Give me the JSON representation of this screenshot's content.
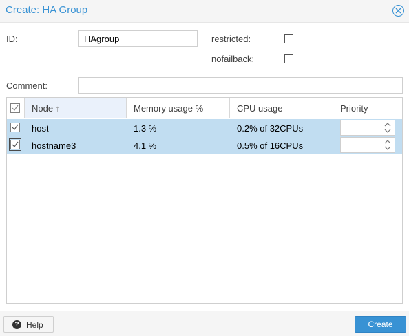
{
  "dialog": {
    "title": "Create: HA Group"
  },
  "form": {
    "id_label": "ID:",
    "id_value": "HAgroup",
    "restricted_label": "restricted:",
    "restricted_checked": false,
    "nofailback_label": "nofailback:",
    "nofailback_checked": false,
    "comment_label": "Comment:",
    "comment_value": ""
  },
  "grid": {
    "columns": [
      {
        "label": "Node",
        "sort": "ascending"
      },
      {
        "label": "Memory usage %"
      },
      {
        "label": "CPU usage"
      },
      {
        "label": "Priority"
      }
    ],
    "select_all_checked": false,
    "rows": [
      {
        "node": "host",
        "memory": "1.3 %",
        "cpu": "0.2% of 32CPUs",
        "priority": "",
        "checked": true
      },
      {
        "node": "hostname3",
        "memory": "4.1 %",
        "cpu": "0.5% of 16CPUs",
        "priority": "",
        "checked": true
      }
    ]
  },
  "footer": {
    "help_label": "Help",
    "create_label": "Create"
  },
  "colors": {
    "accent": "#3892d4",
    "selected_row": "#c1ddf1"
  },
  "icons": {
    "close": "close-icon",
    "help": "help-icon",
    "sort": "sort-ascending-icon",
    "spinner": "spinner-arrows-icon"
  }
}
